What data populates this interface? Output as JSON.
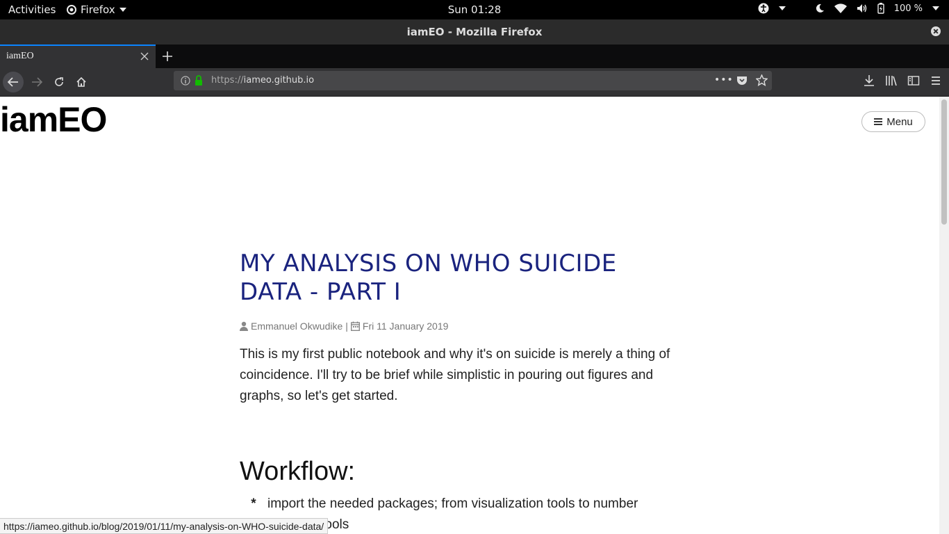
{
  "system_bar": {
    "activities": "Activities",
    "app_name": "Firefox",
    "clock": "Sun 01:28",
    "battery": "100 %"
  },
  "window": {
    "title": "iamEO - Mozilla Firefox"
  },
  "tabs": [
    {
      "label": "iamEO"
    }
  ],
  "address_bar": {
    "scheme": "https://",
    "host": "iameo.github.io"
  },
  "site": {
    "brand": "iamEO",
    "menu_label": "Menu"
  },
  "post": {
    "title": "MY ANALYSIS ON WHO SUICIDE DATA - PART I",
    "author": "Emmanuel Okwudike",
    "separator": "|",
    "date": "Fri 11 January 2019",
    "intro": "This is my first public notebook and why it's on suicide is merely a thing of coincidence. I'll try to be brief while simplistic in pouring out figures and graphs, so let's get started.",
    "section_heading": "Workflow:",
    "list_items": [
      "import the needed packages; from visualization tools to number handling tools"
    ]
  },
  "status_bar": {
    "link_url": "https://iameo.github.io/blog/2019/01/11/my-analysis-on-WHO-suicide-data/"
  },
  "colors": {
    "title_accent": "#1a237e",
    "tab_highlight": "#0a84ff",
    "lock_green": "#12bc00"
  }
}
